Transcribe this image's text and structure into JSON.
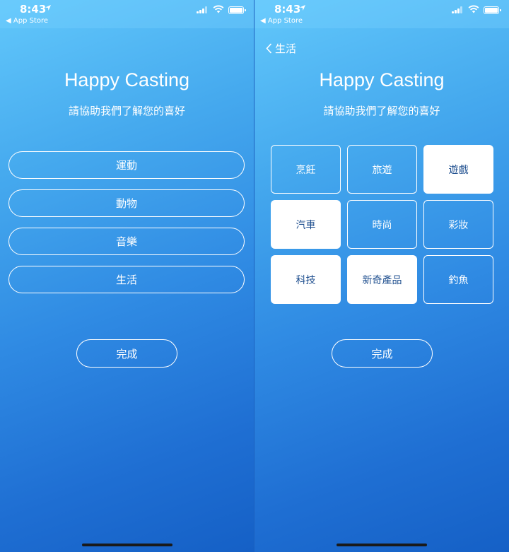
{
  "status": {
    "time": "8:43",
    "back_app": "◀ App Store"
  },
  "left": {
    "title": "Happy Casting",
    "subtitle": "請協助我們了解您的喜好",
    "categories": [
      "運動",
      "動物",
      "音樂",
      "生活"
    ],
    "done_label": "完成"
  },
  "right": {
    "back_label": "生活",
    "title": "Happy Casting",
    "subtitle": "請協助我們了解您的喜好",
    "tiles": [
      {
        "label": "烹飪",
        "selected": false
      },
      {
        "label": "旅遊",
        "selected": false
      },
      {
        "label": "遊戲",
        "selected": true
      },
      {
        "label": "汽車",
        "selected": true
      },
      {
        "label": "時尚",
        "selected": false
      },
      {
        "label": "彩妝",
        "selected": false
      },
      {
        "label": "科技",
        "selected": true
      },
      {
        "label": "新奇產品",
        "selected": true
      },
      {
        "label": "釣魚",
        "selected": false
      }
    ],
    "done_label": "完成"
  },
  "colors": {
    "gradient_top": "#62c8fb",
    "gradient_bottom": "#1560c6",
    "selected_tile_text": "#1f4f8f"
  }
}
